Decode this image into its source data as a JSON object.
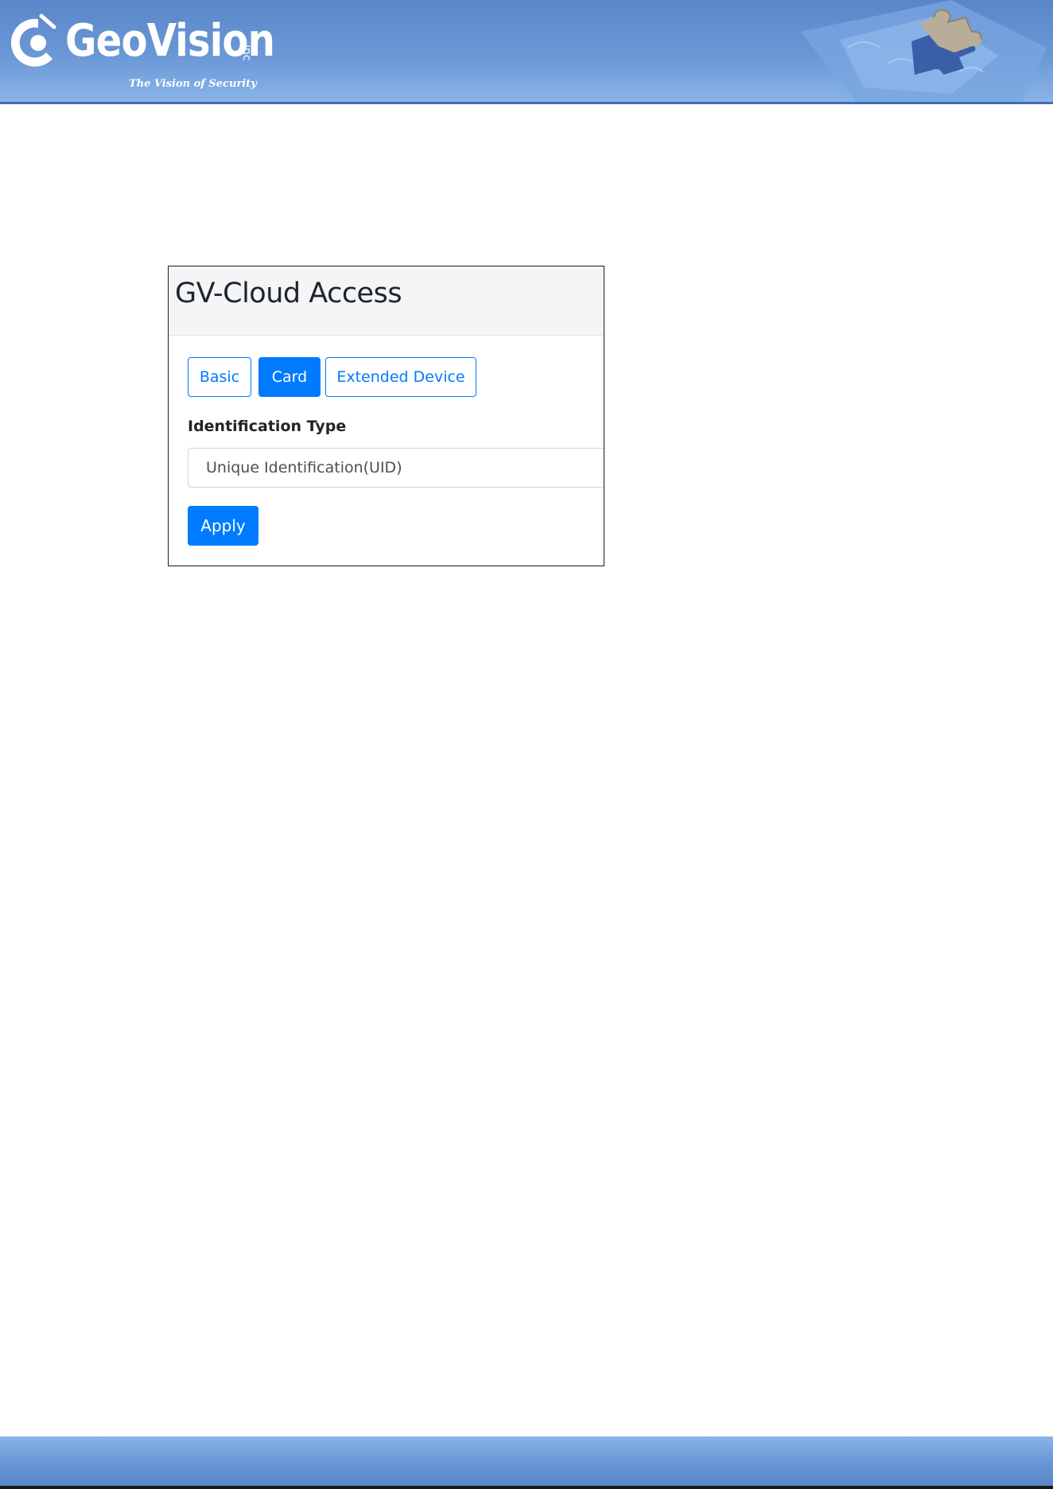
{
  "header": {
    "logo_text": "GeoVision",
    "logo_suffix": "inc",
    "tagline": "The Vision of Security"
  },
  "panel": {
    "title": "GV-Cloud Access",
    "tabs": [
      {
        "label": "Basic",
        "active": false
      },
      {
        "label": "Card",
        "active": true
      },
      {
        "label": "Extended Device",
        "active": false
      }
    ],
    "identification_type": {
      "label": "Identification Type",
      "selected_value": "Unique Identification(UID)"
    },
    "apply_label": "Apply"
  },
  "colors": {
    "brand_blue": "#6a98d6",
    "primary_button": "#007bff",
    "header_gray": "#f4f5f7"
  }
}
